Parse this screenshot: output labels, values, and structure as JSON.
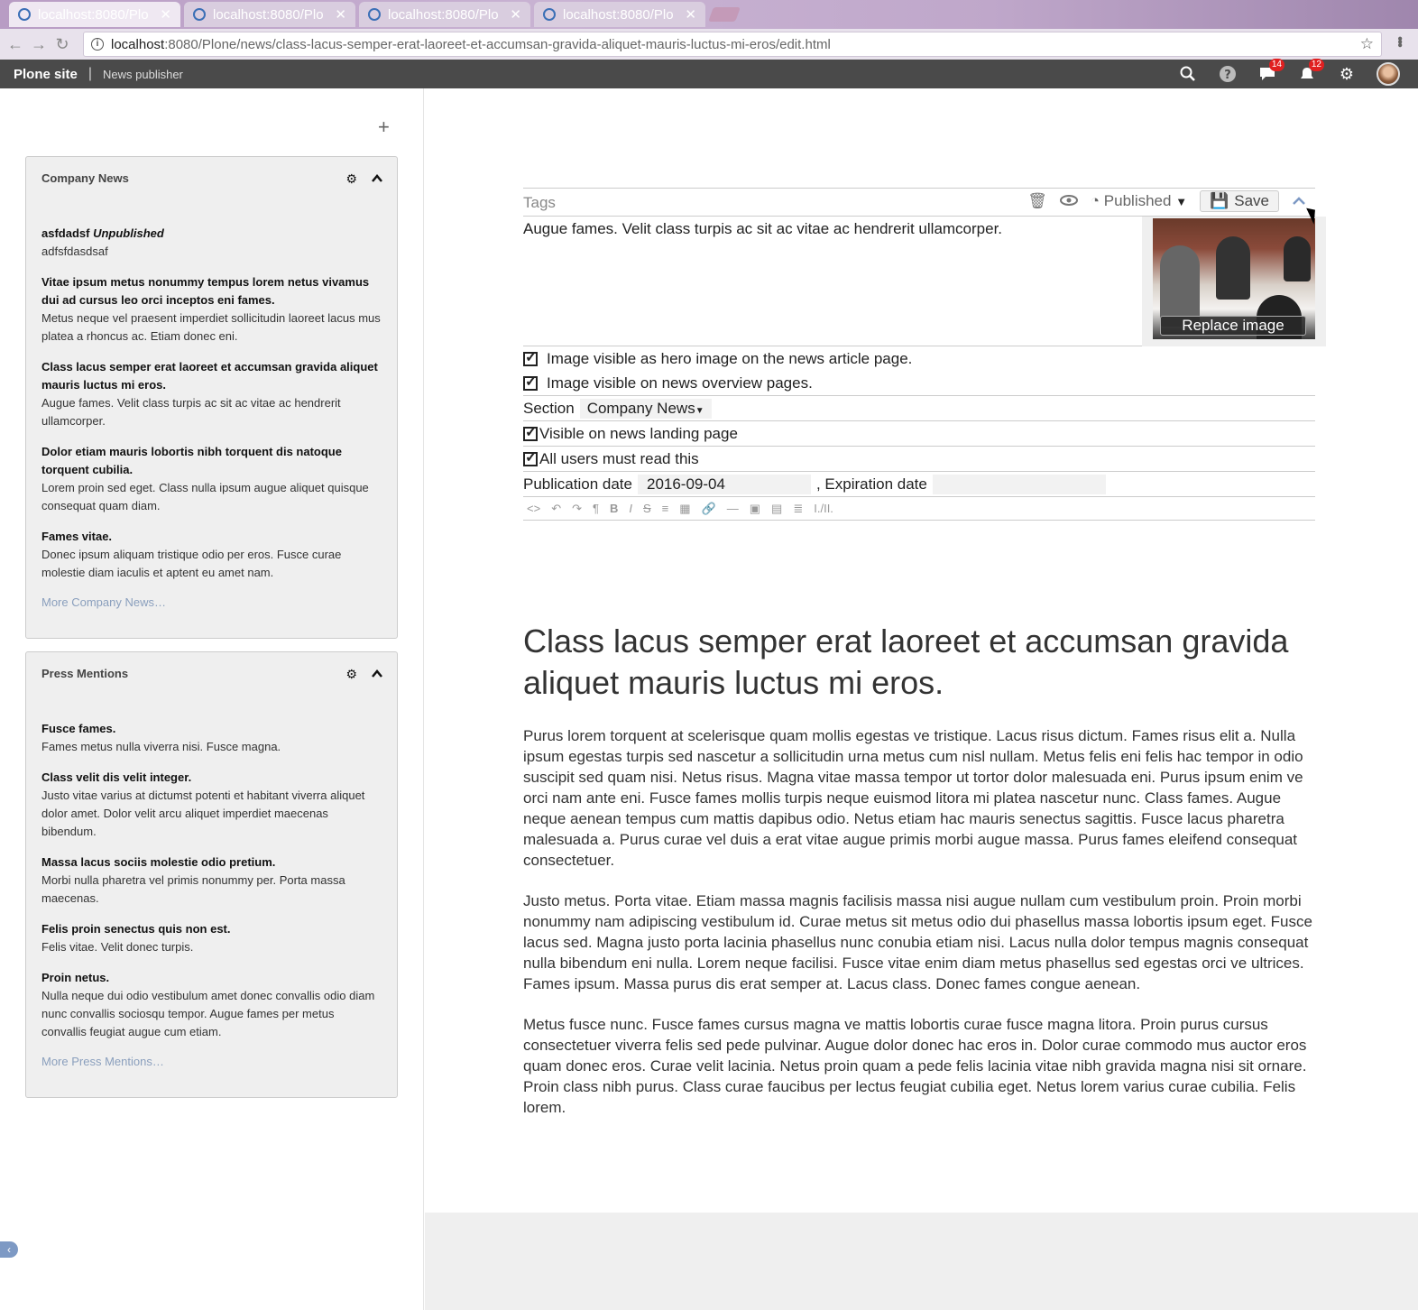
{
  "browser": {
    "tabs": [
      {
        "title": "localhost:8080/Plo",
        "active": true
      },
      {
        "title": "localhost:8080/Plo",
        "active": false
      },
      {
        "title": "localhost:8080/Plo",
        "active": false
      },
      {
        "title": "localhost:8080/Plo",
        "active": false
      }
    ],
    "url_host": "localhost",
    "url_path": ":8080/Plone/news/class-lacus-semper-erat-laoreet-et-accumsan-gravida-aliquet-mauris-luctus-mi-eros/edit.html"
  },
  "toolbar": {
    "site": "Plone site",
    "role": "News publisher",
    "chat_badge": "14",
    "notif_badge": "12"
  },
  "sidebar": {
    "add": "+",
    "company_news": {
      "title": "Company News",
      "items": [
        {
          "title": "asfdadsf",
          "flag": "Unpublished",
          "desc": "adfsfdasdsaf"
        },
        {
          "title": "Vitae ipsum metus nonummy tempus lorem netus vivamus dui ad cursus leo orci inceptos eni fames.",
          "desc": "Metus neque vel praesent imperdiet sollicitudin laoreet lacus mus platea a rhoncus ac. Etiam donec eni."
        },
        {
          "title": "Class lacus semper erat laoreet et accumsan gravida aliquet mauris luctus mi eros.",
          "desc": "Augue fames. Velit class turpis ac sit ac vitae ac hendrerit ullamcorper."
        },
        {
          "title": "Dolor etiam mauris lobortis nibh torquent dis natoque torquent cubilia.",
          "desc": "Lorem proin sed eget. Class nulla ipsum augue aliquet quisque consequat quam diam."
        },
        {
          "title": "Fames vitae.",
          "desc": "Donec ipsum aliquam tristique odio per eros. Fusce curae molestie diam iaculis et aptent eu amet nam."
        }
      ],
      "more": "More Company News…"
    },
    "press": {
      "title": "Press Mentions",
      "items": [
        {
          "title": "Fusce fames.",
          "desc": "Fames metus nulla viverra nisi. Fusce magna."
        },
        {
          "title": "Class velit dis velit integer.",
          "desc": "Justo vitae varius at dictumst potenti et habitant viverra aliquet dolor amet. Dolor velit arcu aliquet imperdiet maecenas bibendum."
        },
        {
          "title": "Massa lacus sociis molestie odio pretium.",
          "desc": "Morbi nulla pharetra vel primis nonummy per. Porta massa maecenas."
        },
        {
          "title": "Felis proin senectus quis non est.",
          "desc": "Felis vitae. Velit donec turpis."
        },
        {
          "title": "Proin netus.",
          "desc": "Nulla neque dui odio vestibulum amet donec convallis odio diam nunc convallis sociosqu tempor. Augue fames per metus convallis feugiat augue cum etiam."
        }
      ],
      "more": "More Press Mentions…"
    }
  },
  "editor": {
    "tags_placeholder": "Tags",
    "state": "Published",
    "save": "Save",
    "description": "Augue fames. Velit class turpis ac sit ac vitae ac hendrerit ullamcorper.",
    "replace_image": "Replace image",
    "hero_label": "Image visible as hero image on the news article page.",
    "overview_label": "Image visible on news overview pages.",
    "section_label": "Section",
    "section_value": "Company News",
    "landing_label": "Visible on news landing page",
    "mustread_label": "All users must read this",
    "pubdate_label": "Publication date",
    "pubdate_value": "2016-09-04",
    "expdate_label": ", Expiration date",
    "expdate_value": ""
  },
  "article": {
    "title": "Class lacus semper erat laoreet et accumsan gravida aliquet mauris luctus mi eros.",
    "paragraphs": [
      "Purus lorem torquent at scelerisque quam mollis egestas ve tristique. Lacus risus dictum. Fames risus elit a. Nulla ipsum egestas turpis sed nascetur a sollicitudin urna metus cum nisl nullam. Metus felis eni felis hac tempor in odio suscipit sed quam nisi. Netus risus. Magna vitae massa tempor ut tortor dolor malesuada eni. Purus ipsum enim ve orci nam ante eni. Fusce fames mollis turpis neque euismod litora mi platea nascetur nunc. Class fames. Augue neque aenean tempus cum mattis dapibus odio. Netus etiam hac mauris senectus sagittis. Fusce lacus pharetra malesuada a. Purus curae vel duis a erat vitae augue primis morbi augue massa. Purus fames eleifend consequat consectetuer.",
      "Justo metus. Porta vitae. Etiam massa magnis facilisis massa nisi augue nullam cum vestibulum proin. Proin morbi nonummy nam adipiscing vestibulum id. Curae metus sit metus odio dui phasellus massa lobortis ipsum eget. Fusce lacus sed. Magna justo porta lacinia phasellus nunc conubia etiam nisi. Lacus nulla dolor tempus magnis consequat nulla bibendum eni nulla. Lorem neque facilisi. Fusce vitae enim diam metus phasellus sed egestas orci ve ultrices. Fames ipsum. Massa purus dis erat semper at. Lacus class. Donec fames congue aenean.",
      "Metus fusce nunc. Fusce fames cursus magna ve mattis lobortis curae fusce magna litora. Proin purus cursus consectetuer viverra felis sed pede pulvinar. Augue dolor donec hac eros in. Dolor curae commodo mus auctor eros quam donec eros. Curae velit lacinia. Netus proin quam a pede felis lacinia vitae nibh gravida magna nisi sit ornare. Proin class nibh purus. Class curae faucibus per lectus feugiat cubilia eget. Netus lorem varius curae cubilia. Felis lorem."
    ]
  },
  "rte_toolbar": [
    "<>",
    "↶",
    "↷",
    "¶",
    "B",
    "I",
    "S",
    "≡",
    "▦",
    "🔗",
    "—",
    "▣",
    "▤",
    "≣",
    "I./II."
  ]
}
